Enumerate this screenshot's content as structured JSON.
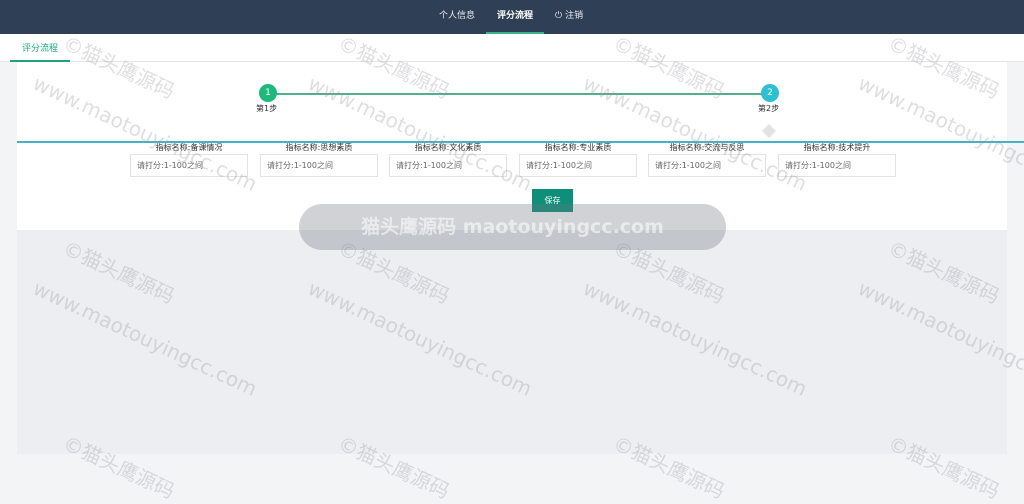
{
  "nav": {
    "items": [
      {
        "label": "个人信息",
        "active": false
      },
      {
        "label": "评分流程",
        "active": true
      },
      {
        "label": "注销",
        "active": false
      }
    ],
    "logout_icon": "power-icon"
  },
  "tab": {
    "label": "评分流程"
  },
  "steps": [
    {
      "number": "1",
      "label": "第1步"
    },
    {
      "number": "2",
      "label": "第2步"
    }
  ],
  "fields": [
    {
      "label": "指标名称:备课情况",
      "placeholder": "请打分:1-100之间"
    },
    {
      "label": "指标名称:思想素质",
      "placeholder": "请打分:1-100之间"
    },
    {
      "label": "指标名称:文化素质",
      "placeholder": "请打分:1-100之间"
    },
    {
      "label": "指标名称:专业素质",
      "placeholder": "请打分:1-100之间"
    },
    {
      "label": "指标名称:交流与反思",
      "placeholder": "请打分:1-100之间"
    },
    {
      "label": "指标名称:技术提升",
      "placeholder": "请打分:1-100之间"
    }
  ],
  "save_label": "保存",
  "watermark": {
    "line1": "©猫头鹰源码",
    "line2": "www.maotouyingcc.com",
    "banner": "猫头鹰源码 maotouyingcc.com"
  },
  "colors": {
    "topbar": "#2f3f55",
    "accent": "#1fa37f",
    "save": "#0f8f79",
    "step1": "#1fb87d",
    "step2": "#2cc0d0"
  }
}
